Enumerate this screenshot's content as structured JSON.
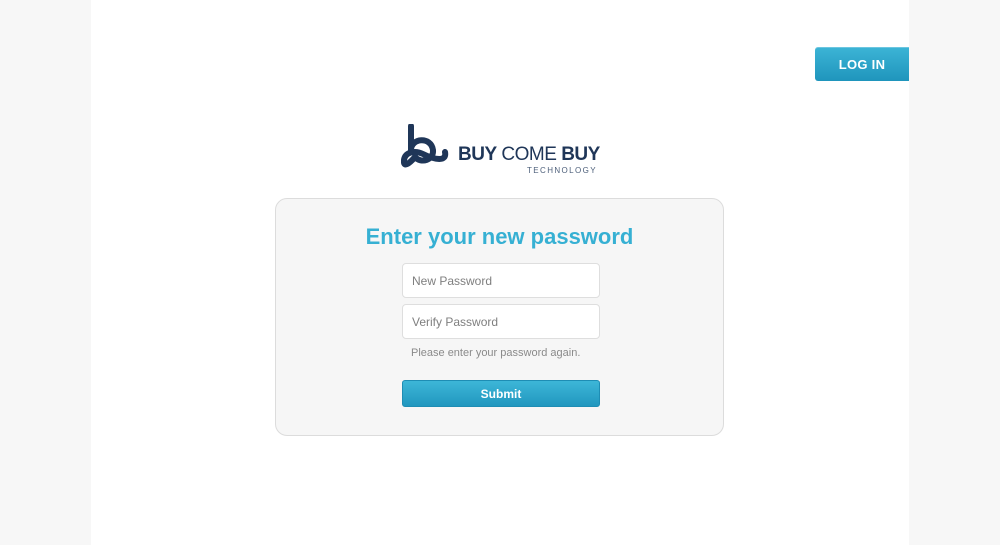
{
  "header": {
    "login_label": "LOG IN"
  },
  "logo": {
    "title_bold_1": "BUY",
    "title_light": " COME ",
    "title_bold_2": "BUY",
    "subtitle": "TECHNOLOGY",
    "icon": "buycomebuy-logo-mark"
  },
  "form": {
    "title": "Enter your new password",
    "new_password_placeholder": "New Password",
    "new_password_value": "",
    "verify_password_placeholder": "Verify Password",
    "verify_password_value": "",
    "hint": "Please enter your password again.",
    "submit_label": "Submit"
  },
  "colors": {
    "accent": "#36b0d3",
    "button": "#2aa5cc",
    "logo_navy": "#1f3658",
    "background": "#f7f7f7"
  }
}
